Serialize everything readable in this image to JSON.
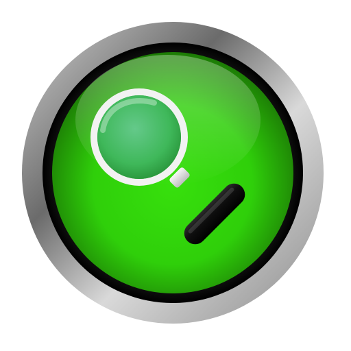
{
  "icon": {
    "name": "magnifying-glass-icon"
  },
  "colors": {
    "background": "#ffffff",
    "bezel_dark": "#0a0a0a",
    "bezel_light": "#d6d6d6",
    "button_green": "#2fcf0a",
    "button_green_dark": "#1f7f05",
    "lens_tint": "#3fb85a",
    "lens_ring": "#f2f2f2",
    "handle": "#141414"
  }
}
